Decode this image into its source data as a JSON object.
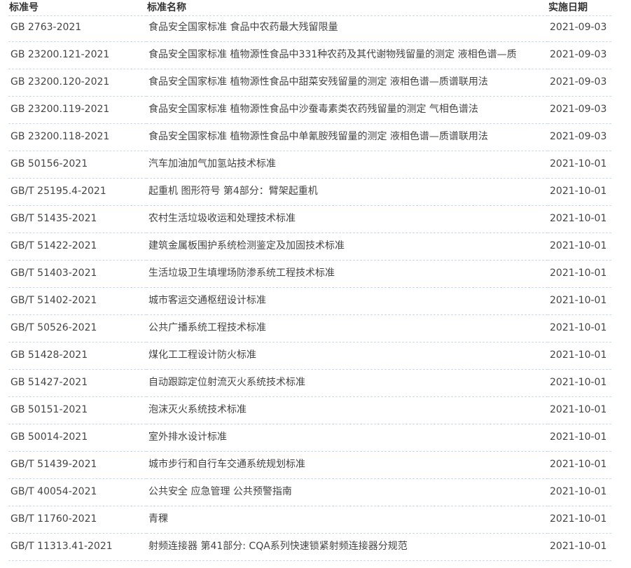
{
  "headers": {
    "code": "标准号",
    "name": "标准名称",
    "date": "实施日期"
  },
  "rows": [
    {
      "code": "GB 2763-2021",
      "name": "食品安全国家标准 食品中农药最大残留限量",
      "date": "2021-09-03"
    },
    {
      "code": "GB 23200.121-2021",
      "name": "食品安全国家标准 植物源性食品中331种农药及其代谢物残留量的测定 液相色谱—质",
      "date": "2021-09-03"
    },
    {
      "code": "GB 23200.120-2021",
      "name": "食品安全国家标准 植物源性食品中甜菜安残留量的测定 液相色谱—质谱联用法",
      "date": "2021-09-03"
    },
    {
      "code": "GB 23200.119-2021",
      "name": "食品安全国家标准 植物源性食品中沙蚕毒素类农药残留量的测定 气相色谱法",
      "date": "2021-09-03"
    },
    {
      "code": "GB 23200.118-2021",
      "name": "食品安全国家标准 植物源性食品中单氰胺残留量的测定 液相色谱—质谱联用法",
      "date": "2021-09-03"
    },
    {
      "code": "GB 50156-2021",
      "name": "汽车加油加气加氢站技术标准",
      "date": "2021-10-01"
    },
    {
      "code": "GB/T 25195.4-2021",
      "name": "起重机 图形符号 第4部分：臂架起重机",
      "date": "2021-10-01"
    },
    {
      "code": "GB/T 51435-2021",
      "name": "农村生活垃圾收运和处理技术标准",
      "date": "2021-10-01"
    },
    {
      "code": "GB/T 51422-2021",
      "name": "建筑金属板围护系统检测鉴定及加固技术标准",
      "date": "2021-10-01"
    },
    {
      "code": "GB/T 51403-2021",
      "name": "生活垃圾卫生填埋场防渗系统工程技术标准",
      "date": "2021-10-01"
    },
    {
      "code": "GB/T 51402-2021",
      "name": "城市客运交通枢纽设计标准",
      "date": "2021-10-01"
    },
    {
      "code": "GB/T 50526-2021",
      "name": "公共广播系统工程技术标准",
      "date": "2021-10-01"
    },
    {
      "code": "GB 51428-2021",
      "name": "煤化工工程设计防火标准",
      "date": "2021-10-01"
    },
    {
      "code": "GB 51427-2021",
      "name": "自动跟踪定位射流灭火系统技术标准",
      "date": "2021-10-01"
    },
    {
      "code": "GB 50151-2021",
      "name": "泡沫灭火系统技术标准",
      "date": "2021-10-01"
    },
    {
      "code": "GB 50014-2021",
      "name": "室外排水设计标准",
      "date": "2021-10-01"
    },
    {
      "code": "GB/T 51439-2021",
      "name": "城市步行和自行车交通系统规划标准",
      "date": "2021-10-01"
    },
    {
      "code": "GB/T 40054-2021",
      "name": "公共安全 应急管理 公共预警指南",
      "date": "2021-10-01"
    },
    {
      "code": "GB/T 11760-2021",
      "name": "青稞",
      "date": "2021-10-01"
    },
    {
      "code": "GB/T 11313.41-2021",
      "name": "射频连接器 第41部分: CQA系列快速锁紧射频连接器分规范",
      "date": "2021-10-01"
    }
  ]
}
